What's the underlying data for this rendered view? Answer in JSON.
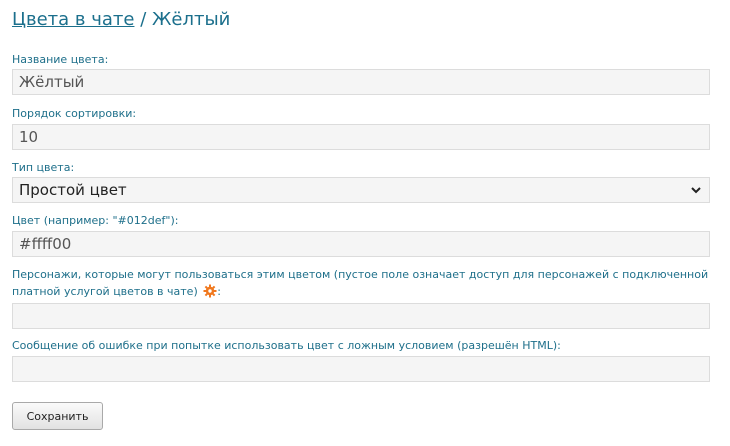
{
  "header": {
    "breadcrumb_link": "Цвета в чате",
    "separator": "/",
    "current": "Жёлтый"
  },
  "form": {
    "color_name": {
      "label": "Название цвета:",
      "value": "Жёлтый"
    },
    "sort_order": {
      "label": "Порядок сортировки:",
      "value": "10"
    },
    "color_type": {
      "label": "Тип цвета:",
      "value": "Простой цвет"
    },
    "color_code": {
      "label": "Цвет (например: \"#012def\"):",
      "value": "#ffff00"
    },
    "characters": {
      "label": "Персонажи, которые могут пользоваться этим цветом (пустое поле означает доступ для персонажей с подключенной платной услугой цветов в чате)",
      "label_suffix": ":",
      "value": ""
    },
    "error_message": {
      "label": "Сообщение об ошибке при попытке использовать цвет с ложным условием (разрешён HTML):",
      "value": ""
    },
    "save_label": "Сохранить"
  },
  "colors": {
    "accent": "#1b6f8c",
    "label": "#1e6f8a",
    "field_bg": "#f5f5f5",
    "gear": "#f0781e"
  }
}
